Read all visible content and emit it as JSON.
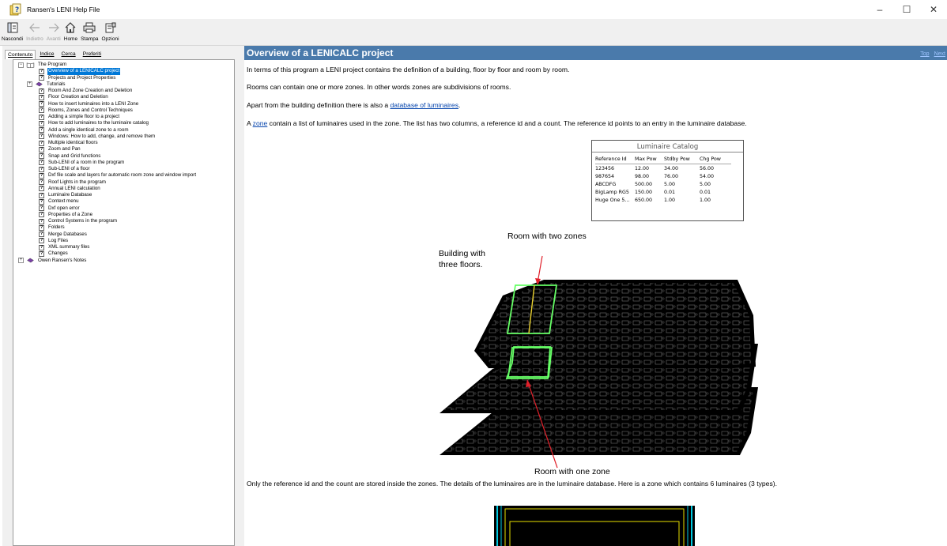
{
  "window": {
    "title": "Ransen's LENI Help File",
    "controls": [
      "–",
      "☐",
      "✕"
    ]
  },
  "toolbar": {
    "buttons": [
      {
        "label": "Nascondi",
        "icon": "hide-icon",
        "enabled": true
      },
      {
        "label": "Indietro",
        "icon": "back-arrow-icon",
        "enabled": false
      },
      {
        "label": "Avanti",
        "icon": "forward-arrow-icon",
        "enabled": false
      },
      {
        "label": "Home",
        "icon": "home-icon",
        "enabled": true
      },
      {
        "label": "Stampa",
        "icon": "print-icon",
        "enabled": true
      },
      {
        "label": "Opzioni",
        "icon": "options-icon",
        "enabled": true
      }
    ]
  },
  "tabs": {
    "contenuto": "Contenuto",
    "indice": "Indice",
    "cerca": "Cerca",
    "preferiti": "Preferiti"
  },
  "tree": {
    "root": "The Program",
    "items": [
      "Overview of a LENICALC project",
      "Projects and Project Properties",
      "Tutorials",
      "Room And Zone Creation and Deletion",
      "Floor Creation and Deletion",
      "How to insert luminaires into a LENI Zone",
      "Rooms, Zones and Control Techniques",
      "Adding a simple floor to a project",
      "How to add luminaires to the luminaire catalog",
      "Add a single identical zone to a room",
      "Windows: How to add, change, and remove them",
      "Multiple identical floors",
      "Zoom and Pan",
      "Snap and Grid functions",
      "Sub-LENI of a room in the program",
      "Sub-LENI of a floor",
      "Dxf file scale and layers for automatic room zone and window import",
      "Roof Lights in the program",
      "Annual LENI calculation",
      "Luminaire Database",
      "Context menu",
      "Dxf open error",
      "Properties of a Zone",
      "Control Systems in the program",
      "Folders",
      "Merge Databases",
      "Log Files",
      "XML summary files",
      "Changes"
    ],
    "last_root": "Owen Ransen's Notes"
  },
  "content": {
    "title": "Overview of a LENICALC project",
    "link_top": "Top",
    "link_next": "Next",
    "p1": "In terms of this program a LENI project contains the definition of a building, floor by floor and room by room.",
    "p2": "Rooms can contain one or more zones. In other words zones are subdivisions of rooms.",
    "p3_pre": "Apart from the building definition there is also a ",
    "p3_link": "database of luminaires",
    "p3_post": ".",
    "p4_pre": "A ",
    "p4_link": "zone",
    "p4_post": " contain a list of luminaires used in the zone. The list has two columns, a reference id and a count. The reference id points to an entry in the luminaire database.",
    "p5": "Only the reference id and the count are stored inside the zones. The details of the luminaires are in the luminaire database. Here is a zone which contains 6 luminaires (3 types)."
  },
  "catalog": {
    "title": "Luminaire Catalog",
    "headers": [
      "Reference Id",
      "Max Pow",
      "Stdby Pow",
      "Chg Pow"
    ],
    "rows": [
      [
        "123456",
        "12.00",
        "34.00",
        "56.00"
      ],
      [
        "987654",
        "98.00",
        "76.00",
        "54.00"
      ],
      [
        "ABCDFG",
        "500.00",
        "5.00",
        "5.00"
      ],
      [
        "BigLamp RG5",
        "150.00",
        "0.01",
        "0.01"
      ],
      [
        "Huge One 5...",
        "650.00",
        "1.00",
        "1.00"
      ]
    ]
  },
  "diagram": {
    "label_two_zones": "Room with two zones",
    "label_building_1": "Building with",
    "label_building_2": "three floors.",
    "label_one_zone": "Room with one zone"
  },
  "colors": {
    "header_bar": "#4a7aab",
    "selection": "#0078d7",
    "link": "#0645ad",
    "zone_outline": "#66ff66",
    "arrow": "#e0202a"
  }
}
